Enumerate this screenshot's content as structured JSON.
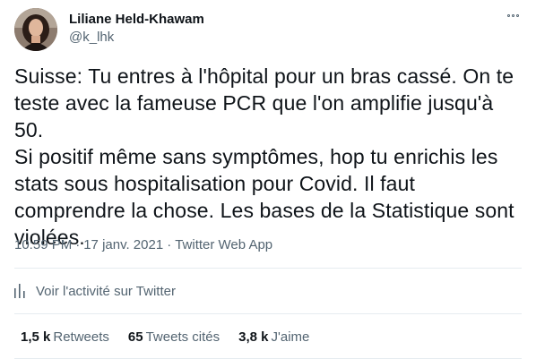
{
  "author": {
    "display_name": "Liliane Held-Khawam",
    "handle": "@k_lhk",
    "avatar": "profile-photo"
  },
  "tweet": {
    "text": "Suisse: Tu entres à l'hôpital pour un bras cassé. On te\nteste avec la fameuse PCR que l'on amplifie jusqu'à 50.\nSi positif même sans symptômes, hop tu enrichis les\nstats sous hospitalisation pour Covid. Il faut\ncomprendre la chose. Les bases de la Statistique sont\nviolées.",
    "time": "10:59 PM",
    "separator": "·",
    "date": "17 janv. 2021",
    "source": "Twitter Web App"
  },
  "activity": {
    "label": "Voir l'activité sur Twitter",
    "icon": "analytics-icon"
  },
  "stats": {
    "retweets_count": "1,5 k",
    "retweets_label": "Retweets",
    "quotes_count": "65",
    "quotes_label": "Tweets cités",
    "likes_count": "3,8 k",
    "likes_label": "J'aime"
  },
  "colors": {
    "text": "#0f1419",
    "secondary": "#536471",
    "divider": "#e6ecf0"
  }
}
